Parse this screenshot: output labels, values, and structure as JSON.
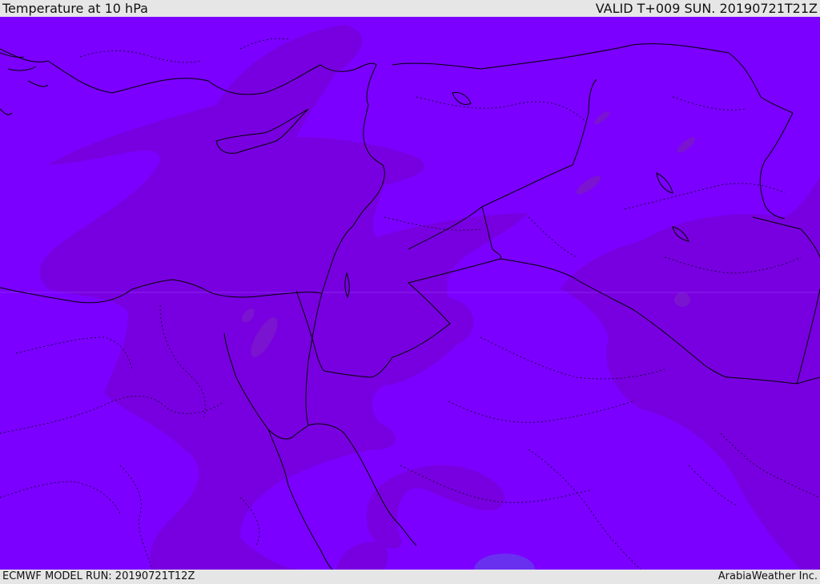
{
  "header": {
    "title": "Temperature at 10 hPa",
    "valid": "VALID T+009 SUN. 20190721T21Z"
  },
  "footer": {
    "model_run": "ECMWF MODEL RUN: 20190721T12Z",
    "credit": "ArabiaWeather Inc."
  },
  "map": {
    "colors": {
      "field_base": "#7b00ff",
      "field_warm": "#7800e0",
      "field_warmest": "#7a14d0",
      "cold_spot": "#6a30f0",
      "coastline": "#000000",
      "bar_background": "#e6e6e6"
    }
  }
}
